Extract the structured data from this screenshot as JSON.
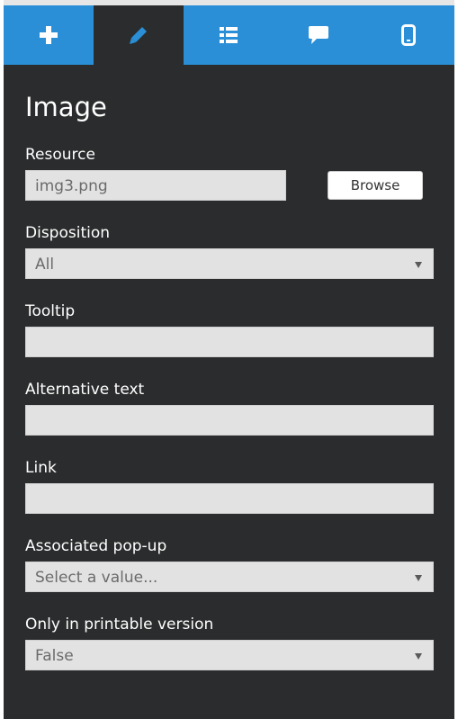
{
  "colors": {
    "panel_bg": "#2b2c2d",
    "tab_bg": "#2a8fd6",
    "tab_active_bg": "#2b2c2d",
    "field_bg": "#e2e2e2"
  },
  "tabs": [
    {
      "icon": "plus-icon",
      "active": false
    },
    {
      "icon": "pencil-icon",
      "active": true
    },
    {
      "icon": "list-icon",
      "active": false
    },
    {
      "icon": "comment-icon",
      "active": false
    },
    {
      "icon": "mobile-icon",
      "active": false
    }
  ],
  "panel": {
    "title": "Image",
    "resource": {
      "label": "Resource",
      "value": "img3.png",
      "browse_label": "Browse"
    },
    "disposition": {
      "label": "Disposition",
      "value": "All"
    },
    "tooltip": {
      "label": "Tooltip",
      "value": ""
    },
    "alt_text": {
      "label": "Alternative text",
      "value": ""
    },
    "link": {
      "label": "Link",
      "value": ""
    },
    "popup": {
      "label": "Associated pop-up",
      "value": "Select a value..."
    },
    "printable": {
      "label": "Only in printable version",
      "value": "False"
    }
  }
}
